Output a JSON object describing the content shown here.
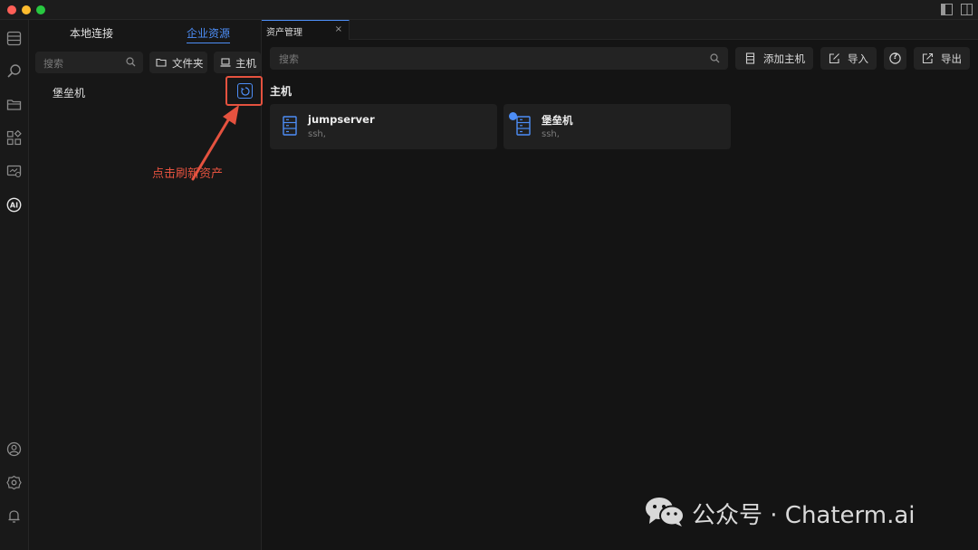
{
  "window": {
    "traffic_lights": [
      "#ff5f57",
      "#febc2e",
      "#28c840"
    ]
  },
  "activity_bar": {
    "icons": [
      "document-list-icon",
      "search-icon",
      "folder-icon",
      "apps-icon",
      "monitor-icon",
      "ai-icon",
      "user-icon",
      "gear-icon",
      "bell-icon"
    ]
  },
  "sidebar": {
    "tabs": [
      "本地连接",
      "企业资源"
    ],
    "active_tab": "企业资源",
    "search_placeholder": "搜索",
    "folder_button": "文件夹",
    "host_button": "主机",
    "tree_items": [
      "堡垒机"
    ]
  },
  "annotation": {
    "text": "点击刷新资产",
    "color": "#e5523f"
  },
  "editor": {
    "tab_label": "资产管理",
    "tab_close": "×",
    "search_placeholder": "搜索",
    "toolbar": {
      "add_host": "添加主机",
      "import": "导入",
      "help": "?",
      "export": "导出"
    },
    "section_title": "主机",
    "hosts": [
      {
        "name": "jumpserver",
        "sub": "ssh,"
      },
      {
        "name": "堡垒机",
        "sub": "ssh,"
      }
    ]
  },
  "accent_color": "#4d8ef7",
  "watermark": {
    "text": "公众号 · Chaterm.ai"
  }
}
